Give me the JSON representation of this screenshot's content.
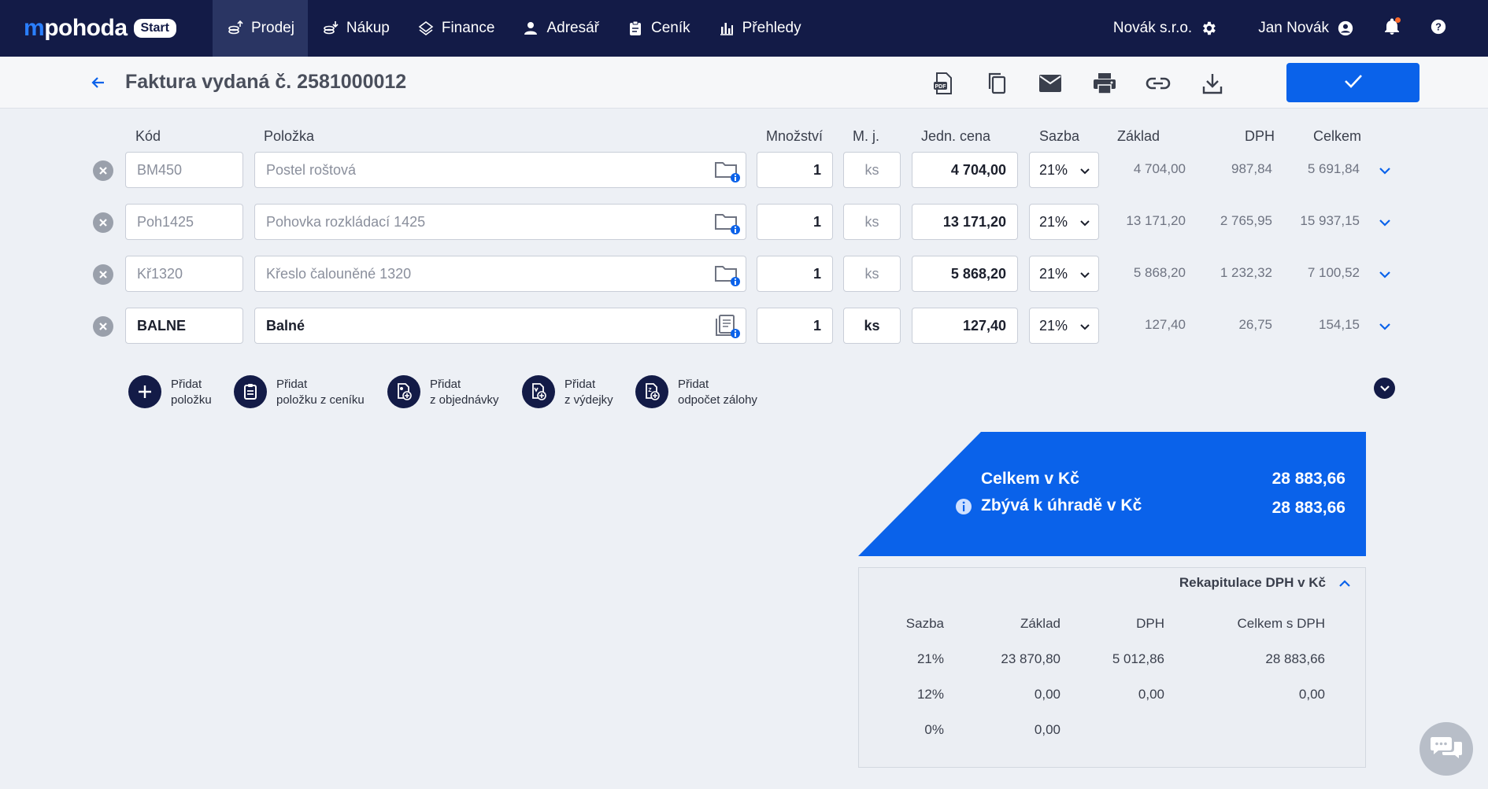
{
  "nav": {
    "logo_m": "m",
    "logo_text": "pohoda",
    "logo_badge": "Start",
    "items": [
      {
        "label": "Prodej",
        "icon": "sales-icon"
      },
      {
        "label": "Nákup",
        "icon": "purchase-icon"
      },
      {
        "label": "Finance",
        "icon": "finance-icon"
      },
      {
        "label": "Adresář",
        "icon": "person-icon"
      },
      {
        "label": "Ceník",
        "icon": "clipboard-icon"
      },
      {
        "label": "Přehledy",
        "icon": "bar-chart-icon"
      }
    ],
    "company": "Novák s.r.o.",
    "user": "Jan Novák"
  },
  "header": {
    "title": "Faktura vydaná č. 2581000012",
    "toolbar": [
      "pdf-icon",
      "copy-icon",
      "mail-icon",
      "print-icon",
      "link-icon",
      "download-icon"
    ]
  },
  "table": {
    "columns": {
      "kod": "Kód",
      "polozka": "Položka",
      "mnozstvi": "Množství",
      "mj": "M. j.",
      "cena": "Jedn. cena",
      "sazba": "Sazba",
      "zaklad": "Základ",
      "dph": "DPH",
      "celkem": "Celkem"
    },
    "rows": [
      {
        "kod": "BM450",
        "polozka": "Postel roštová",
        "mnozstvi": "1",
        "mj": "ks",
        "cena": "4 704,00",
        "sazba": "21%",
        "zaklad": "4 704,00",
        "dph": "987,84",
        "celkem": "5 691,84"
      },
      {
        "kod": "Poh1425",
        "polozka": "Pohovka rozkládací 1425",
        "mnozstvi": "1",
        "mj": "ks",
        "cena": "13 171,20",
        "sazba": "21%",
        "zaklad": "13 171,20",
        "dph": "2 765,95",
        "celkem": "15 937,15"
      },
      {
        "kod": "Kř1320",
        "polozka": "Křeslo čalouněné 1320",
        "mnozstvi": "1",
        "mj": "ks",
        "cena": "5 868,20",
        "sazba": "21%",
        "zaklad": "5 868,20",
        "dph": "1 232,32",
        "celkem": "7 100,52"
      },
      {
        "kod": "BALNE",
        "polozka": "Balné",
        "mnozstvi": "1",
        "mj": "ks",
        "cena": "127,40",
        "sazba": "21%",
        "zaklad": "127,40",
        "dph": "26,75",
        "celkem": "154,15"
      }
    ]
  },
  "add_buttons": [
    {
      "line1": "Přidat",
      "line2": "položku"
    },
    {
      "line1": "Přidat",
      "line2": "položku z ceníku"
    },
    {
      "line1": "Přidat",
      "line2": "z objednávky"
    },
    {
      "line1": "Přidat",
      "line2": "z výdejky"
    },
    {
      "line1": "Přidat",
      "line2": "odpočet zálohy"
    }
  ],
  "totals": {
    "total_label": "Celkem v Kč",
    "total_value": "28 883,66",
    "remaining_label": "Zbývá k úhradě v Kč",
    "remaining_value": "28 883,66",
    "color": "#0a62ea"
  },
  "recap": {
    "title": "Rekapitulace DPH v Kč",
    "headers": [
      "Sazba",
      "Základ",
      "DPH",
      "Celkem s DPH"
    ],
    "rows": [
      [
        "21%",
        "23 870,80",
        "5 012,86",
        "28 883,66"
      ],
      [
        "12%",
        "0,00",
        "0,00",
        "0,00"
      ],
      [
        "0%",
        "0,00",
        "",
        ""
      ]
    ]
  },
  "colors": {
    "nav_bg": "#131b47",
    "accent": "#0a62ea"
  }
}
